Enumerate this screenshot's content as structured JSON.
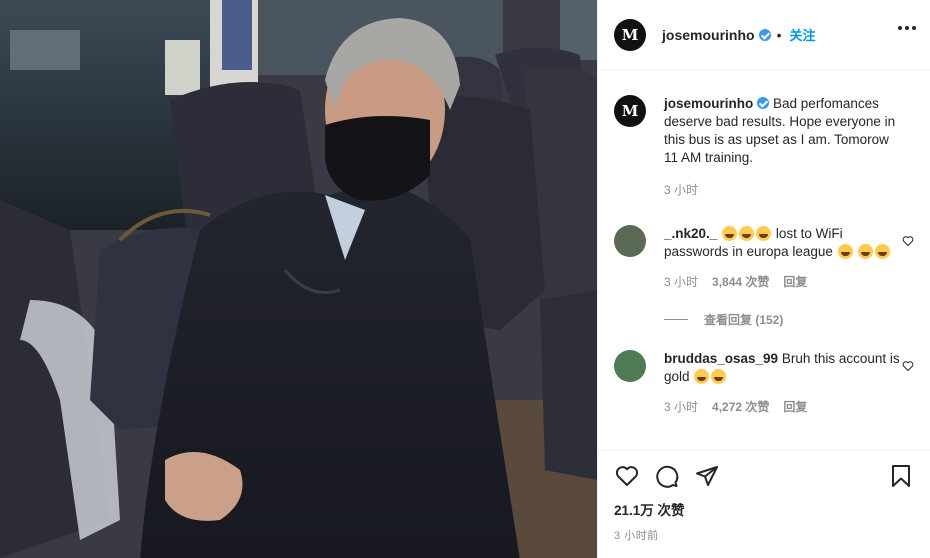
{
  "post": {
    "username": "josemourinho",
    "follow_label": "关注",
    "logo_letter": "M"
  },
  "caption": {
    "username": "josemourinho",
    "text": "Bad perfomances deserve bad results. Hope everyone in this bus is as upset as I am. Tomorow 11 AM training.",
    "time": "3 小时"
  },
  "comments": [
    {
      "username": "_.nk20._",
      "text_before": " lost to WiFi passwords in europa league ",
      "time": "3 小时",
      "likes": "3,844 次赞",
      "reply_label": "回复",
      "view_replies": "查看回复 (152)"
    },
    {
      "username": "bruddas_osas_99",
      "text": "Bruh this account is gold ",
      "time": "3 小时",
      "likes": "4,272 次赞",
      "reply_label": "回复"
    }
  ],
  "footer": {
    "likes": "21.1万 次赞",
    "time": "3 小时前"
  },
  "icons": {
    "like": "heart-icon",
    "comment": "comment-icon",
    "share": "share-icon",
    "save": "bookmark-icon",
    "more": "more-icon"
  },
  "colors": {
    "accent": "#0095f6",
    "verified": "#3897f0",
    "muted": "#8e8e8e"
  }
}
